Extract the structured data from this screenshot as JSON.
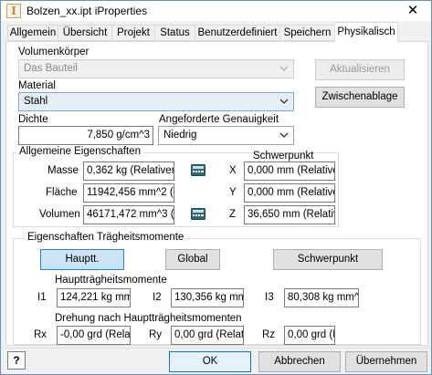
{
  "window": {
    "title": "Bolzen_xx.ipt iProperties",
    "app_icon_letter": "I",
    "close_symbol": "✕"
  },
  "tabs": [
    {
      "label": "Allgemein"
    },
    {
      "label": "Übersicht"
    },
    {
      "label": "Projekt"
    },
    {
      "label": "Status"
    },
    {
      "label": "Benutzerdefiniert"
    },
    {
      "label": "Speichern"
    },
    {
      "label": "Physikalisch"
    }
  ],
  "physical": {
    "volumenkoerper": {
      "label": "Volumenkörper",
      "value": "Das Bauteil"
    },
    "material": {
      "label": "Material",
      "value": "Stahl"
    },
    "dichte": {
      "label": "Dichte",
      "value": "7,850 g/cm^3"
    },
    "genauigkeit": {
      "label": "Angeforderte Genauigkeit",
      "value": "Niedrig"
    },
    "buttons": {
      "update": "Aktualisieren",
      "clipboard": "Zwischenablage"
    },
    "general": {
      "title": "Allgemeine Eigenschaften",
      "masse_label": "Masse",
      "masse_value": "0,362 kg (Relativer",
      "flaeche_label": "Fläche",
      "flaeche_value": "11942,456 mm^2 (",
      "volumen_label": "Volumen",
      "volumen_value": "46171,472 mm^3 (",
      "schwerpunkt_title": "Schwerpunkt",
      "x_label": "X",
      "x_value": "0,000 mm (Relative",
      "y_label": "Y",
      "y_value": "0,000 mm (Relative",
      "z_label": "Z",
      "z_value": "36,650 mm (Relativ"
    },
    "inertia": {
      "title": "Eigenschaften Trägheitsmomente",
      "btn_hauptt": "Hauptt.",
      "btn_global": "Global",
      "btn_schwerpunkt": "Schwerpunkt",
      "haupt_title": "Hauptträgheitsmomente",
      "i1_label": "I1",
      "i1_value": "124,221 kg mm",
      "i2_label": "I2",
      "i2_value": "130,356 kg mm",
      "i3_label": "I3",
      "i3_value": "80,308 kg mm^",
      "rot_title": "Drehung nach Hauptträgheitsmomenten",
      "rx_label": "Rx",
      "rx_value": "-0,00 grd (Rela",
      "ry_label": "Ry",
      "ry_value": "0,00 grd (Relati",
      "rz_label": "Rz",
      "rz_value": "0,00 grd (Relati"
    }
  },
  "footer": {
    "help_symbol": "?",
    "ok": "OK",
    "cancel": "Abbrechen",
    "apply": "Übernehmen"
  }
}
